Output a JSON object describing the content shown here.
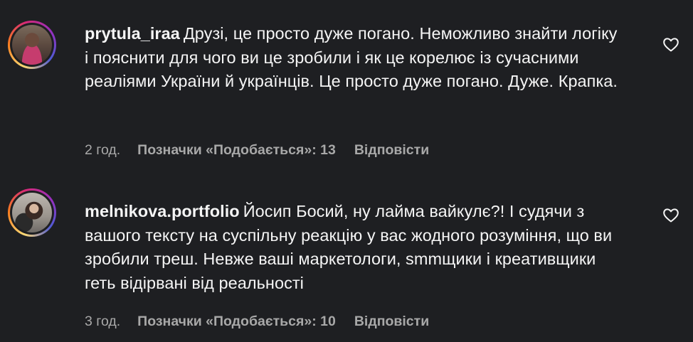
{
  "comments": [
    {
      "username": "prytula_iraa",
      "text": "Друзі, це просто дуже погано. Неможливо знайти логіку і пояснити для чого ви це зробили і як це корелює із сучасними реаліями України й українців. Це просто дуже погано. Дуже. Крапка.",
      "time": "2 год.",
      "likes": "Позначки «Подобається»: 13",
      "reply": "Відповісти",
      "like_icon": "heart-outline-icon"
    },
    {
      "username": "melnikova.portfolio",
      "text": "Йосип Босий, ну лайма вайкулє?! І судячи з вашого тексту на суспільну реакцію у вас жодного розуміння, що ви зробили треш. Невже ваші маркетологи, smmщики і креативщики геть відірвані від реальності",
      "time": "3 год.",
      "likes": "Позначки «Подобається»: 10",
      "reply": "Відповісти",
      "like_icon": "heart-outline-icon"
    }
  ],
  "colors": {
    "background": "#1e1f22",
    "text_primary": "#f5f5f5",
    "text_secondary": "#a8a8a8",
    "story_ring": [
      "#feda75",
      "#fa7e1e",
      "#d62976",
      "#962fbf",
      "#4f5bd5"
    ]
  }
}
